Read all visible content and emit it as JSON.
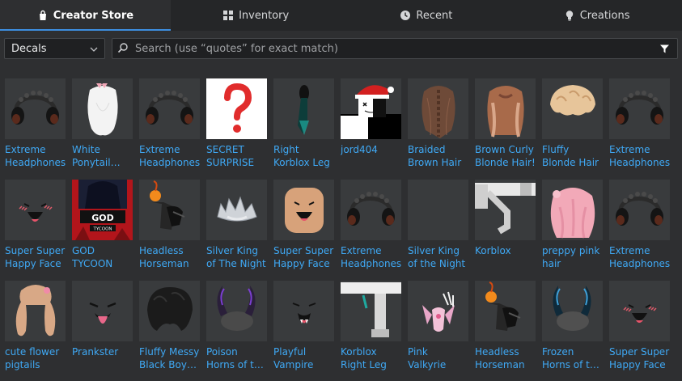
{
  "tabs": [
    {
      "label": "Creator Store",
      "icon": "bag-icon",
      "active": true
    },
    {
      "label": "Inventory",
      "icon": "grid-icon",
      "active": false
    },
    {
      "label": "Recent",
      "icon": "clock-icon",
      "active": false
    },
    {
      "label": "Creations",
      "icon": "lightbulb-icon",
      "active": false
    }
  ],
  "toolbar": {
    "category": "Decals",
    "search_placeholder": "Search (use “quotes” for exact match)"
  },
  "colors": {
    "accent": "#3d8ee0",
    "link": "#3fa9f5",
    "background": "#2e2f31",
    "tab_bar": "#252628",
    "thumb_bg": "#393b3d"
  },
  "items": [
    {
      "label": "Extreme Headphones",
      "thumb": "headphones"
    },
    {
      "label": "White Ponytail Hair",
      "thumb": "white-ponytail"
    },
    {
      "label": "Extreme Headphones",
      "thumb": "headphones"
    },
    {
      "label": "SECRET SURPRISE",
      "thumb": "question-mark"
    },
    {
      "label": "Right Korblox Leg",
      "thumb": "korblox-leg-dark"
    },
    {
      "label": "jord404",
      "thumb": "santa-avatar"
    },
    {
      "label": "Braided Brown Hair",
      "thumb": "braided-hair"
    },
    {
      "label": "Brown Curly Blonde Hair!",
      "thumb": "curly-blonde-hair"
    },
    {
      "label": "Fluffy Blonde Hair",
      "thumb": "fluffy-blonde-hair"
    },
    {
      "label": "Extreme Headphones",
      "thumb": "headphones"
    },
    {
      "label": "Super Super Happy Face",
      "thumb": "happy-face"
    },
    {
      "label": "GOD TYCOON",
      "thumb": "god-tycoon"
    },
    {
      "label": "Headless Horseman",
      "thumb": "headless-horseman"
    },
    {
      "label": "Silver King of The Night",
      "thumb": "silver-crown"
    },
    {
      "label": "Super Super Happy Face",
      "thumb": "happy-face-head"
    },
    {
      "label": "Extreme Headphones",
      "thumb": "headphones"
    },
    {
      "label": "Silver King of the Night",
      "thumb": "empty"
    },
    {
      "label": "Korblox",
      "thumb": "korblox-white"
    },
    {
      "label": "preppy pink hair",
      "thumb": "pink-hair"
    },
    {
      "label": "Extreme Headphones",
      "thumb": "headphones"
    },
    {
      "label": "cute flower pigtails",
      "thumb": "pigtails"
    },
    {
      "label": "Prankster",
      "thumb": "prankster-face"
    },
    {
      "label": "Fluffy Messy Black Boy Hair",
      "thumb": "messy-black-hair"
    },
    {
      "label": "Poison Horns of the Night",
      "thumb": "poison-horns"
    },
    {
      "label": "Playful Vampire",
      "thumb": "vampire-face"
    },
    {
      "label": "Korblox Right Leg",
      "thumb": "korblox-white-leg"
    },
    {
      "label": "Pink Valkyrie",
      "thumb": "pink-valkyrie"
    },
    {
      "label": "Headless Horseman",
      "thumb": "headless-horseman"
    },
    {
      "label": "Frozen Horns of the Night",
      "thumb": "frozen-horns"
    },
    {
      "label": "Super Super Happy Face",
      "thumb": "happy-face"
    }
  ]
}
